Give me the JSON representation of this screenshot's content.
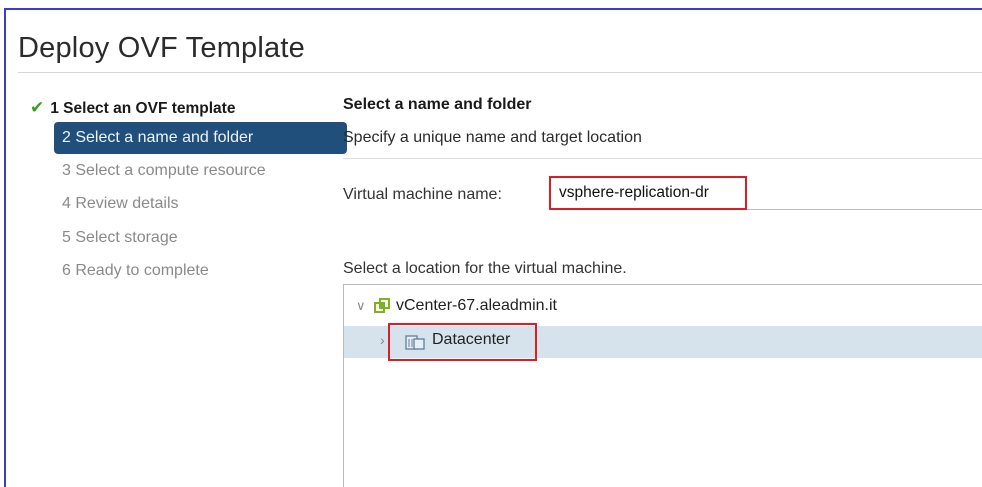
{
  "dialog": {
    "title": "Deploy OVF Template"
  },
  "steps": [
    {
      "label": "1 Select an OVF template",
      "state": "done"
    },
    {
      "label": "2 Select a name and folder",
      "state": "active"
    },
    {
      "label": "3 Select a compute resource",
      "state": "pending"
    },
    {
      "label": "4 Review details",
      "state": "pending"
    },
    {
      "label": "5 Select storage",
      "state": "pending"
    },
    {
      "label": "6 Ready to complete",
      "state": "pending"
    }
  ],
  "panel": {
    "heading": "Select a name and folder",
    "subheading": "Specify a unique name and target location",
    "vm_name_label": "Virtual machine name:",
    "vm_name_value": "vsphere-replication-dr",
    "location_label": "Select a location for the virtual machine."
  },
  "tree": {
    "root": {
      "label": "vCenter-67.aleadmin.it",
      "icon": "vcenter-icon",
      "expanded": true
    },
    "children": [
      {
        "label": "Datacenter",
        "icon": "datacenter-icon",
        "expanded": false,
        "selected": true
      }
    ]
  },
  "colors": {
    "active_step_bg": "#1f4f7a",
    "check": "#3a9d23",
    "highlight_border": "#d81f26",
    "selected_row": "#d7e3ec",
    "vcenter_icon": "#7ab51d"
  }
}
